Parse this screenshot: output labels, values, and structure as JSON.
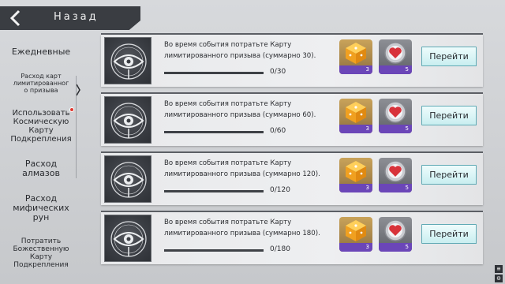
{
  "header": {
    "title": "Назад"
  },
  "sidebar": {
    "items": [
      {
        "label": "Ежедневные"
      },
      {
        "label": "Расход карт лимитированного призыва",
        "lines": [
          "Расход карт",
          "лимитированног",
          "о призыва"
        ]
      },
      {
        "label": "Использовать Космическую Карту Подкрепления",
        "lines": [
          "Использовать",
          "Космическую",
          "Карту",
          "Подкрепления"
        ]
      },
      {
        "label": "Расход алмазов",
        "lines": [
          "Расход",
          "алмазов"
        ]
      },
      {
        "label": "Расход мифических рун",
        "lines": [
          "Расход",
          "мифических",
          "рун"
        ]
      },
      {
        "label": "Потратить Божественную Карту Подкрепления",
        "lines": [
          "Потратить",
          "Божественную",
          "Карту",
          "Подкрепления"
        ]
      }
    ]
  },
  "quests": [
    {
      "desc_line1": "Во время события потратьте Карту",
      "desc_line2": "лимитированного призыва (суммарно 30).",
      "progress": "0/30",
      "progress_fraction": 0,
      "rewards": [
        {
          "icon": "gold-dice-icon",
          "count": "3"
        },
        {
          "icon": "heart-gem-icon",
          "count": "5"
        }
      ],
      "button": "Перейти"
    },
    {
      "desc_line1": "Во время события потратьте Карту",
      "desc_line2": "лимитированного призыва (суммарно 60).",
      "progress": "0/60",
      "progress_fraction": 0,
      "rewards": [
        {
          "icon": "gold-dice-icon",
          "count": "3"
        },
        {
          "icon": "heart-gem-icon",
          "count": "5"
        }
      ],
      "button": "Перейти"
    },
    {
      "desc_line1": "Во время события потратьте Карту",
      "desc_line2": "лимитированного призыва (суммарно 120).",
      "progress": "0/120",
      "progress_fraction": 0,
      "rewards": [
        {
          "icon": "gold-dice-icon",
          "count": "3"
        },
        {
          "icon": "heart-gem-icon",
          "count": "5"
        }
      ],
      "button": "Перейти"
    },
    {
      "desc_line1": "Во время события потратьте Карту",
      "desc_line2": "лимитированного призыва (суммарно 180).",
      "progress": "0/180",
      "progress_fraction": 0,
      "rewards": [
        {
          "icon": "gold-dice-icon",
          "count": "3"
        },
        {
          "icon": "heart-gem-icon",
          "count": "5"
        }
      ],
      "button": "Перейти"
    }
  ],
  "colors": {
    "reward_count_bg": "#6b46b8",
    "button_bg": "#d6f3f4",
    "button_border": "#5fa9b4",
    "notification_dot": "#e0382f"
  },
  "mini_controls": [
    {
      "icon": "list-icon",
      "glyph": "≡"
    },
    {
      "icon": "gear-icon",
      "glyph": "⚙"
    }
  ]
}
